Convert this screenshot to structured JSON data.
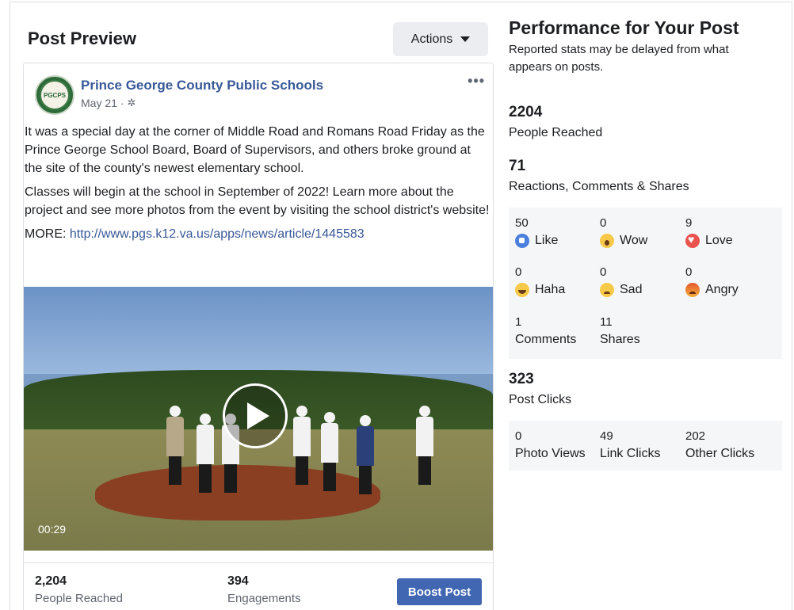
{
  "preview": {
    "title": "Post Preview",
    "actions_label": "Actions"
  },
  "post": {
    "page_name": "Prince George County Public Schools",
    "avatar_text": "PGCPS",
    "date": "May 21 ·",
    "paragraph1": "It was a special day at the corner of Middle Road and Romans Road Friday as the Prince George School Board, Board of Supervisors, and others broke ground at the site of the county's newest elementary school.",
    "paragraph2": "Classes will begin at the school in September of 2022! Learn more about the project and see more photos from the event by visiting the school district's website!",
    "more_prefix": "MORE: ",
    "more_link": "http://www.pgs.k12.va.us/apps/news/article/1445583",
    "video_duration": "00:29"
  },
  "footer": {
    "reached_value": "2,204",
    "reached_label": "People Reached",
    "engagements_value": "394",
    "engagements_label": "Engagements",
    "boost_label": "Boost Post"
  },
  "performance": {
    "title": "Performance for Your Post",
    "subtitle": "Reported stats may be delayed from what appears on posts.",
    "people_reached_value": "2204",
    "people_reached_label": "People Reached",
    "rcs_value": "71",
    "rcs_label": "Reactions, Comments & Shares",
    "reactions": [
      {
        "count": "50",
        "label": "Like"
      },
      {
        "count": "0",
        "label": "Wow"
      },
      {
        "count": "9",
        "label": "Love"
      },
      {
        "count": "0",
        "label": "Haha"
      },
      {
        "count": "0",
        "label": "Sad"
      },
      {
        "count": "0",
        "label": "Angry"
      }
    ],
    "comments_count": "1",
    "comments_label": "Comments",
    "shares_count": "11",
    "shares_label": "Shares",
    "post_clicks_value": "323",
    "post_clicks_label": "Post Clicks",
    "clicks": [
      {
        "count": "0",
        "label": "Photo Views"
      },
      {
        "count": "49",
        "label": "Link Clicks"
      },
      {
        "count": "202",
        "label": "Other Clicks"
      }
    ]
  }
}
